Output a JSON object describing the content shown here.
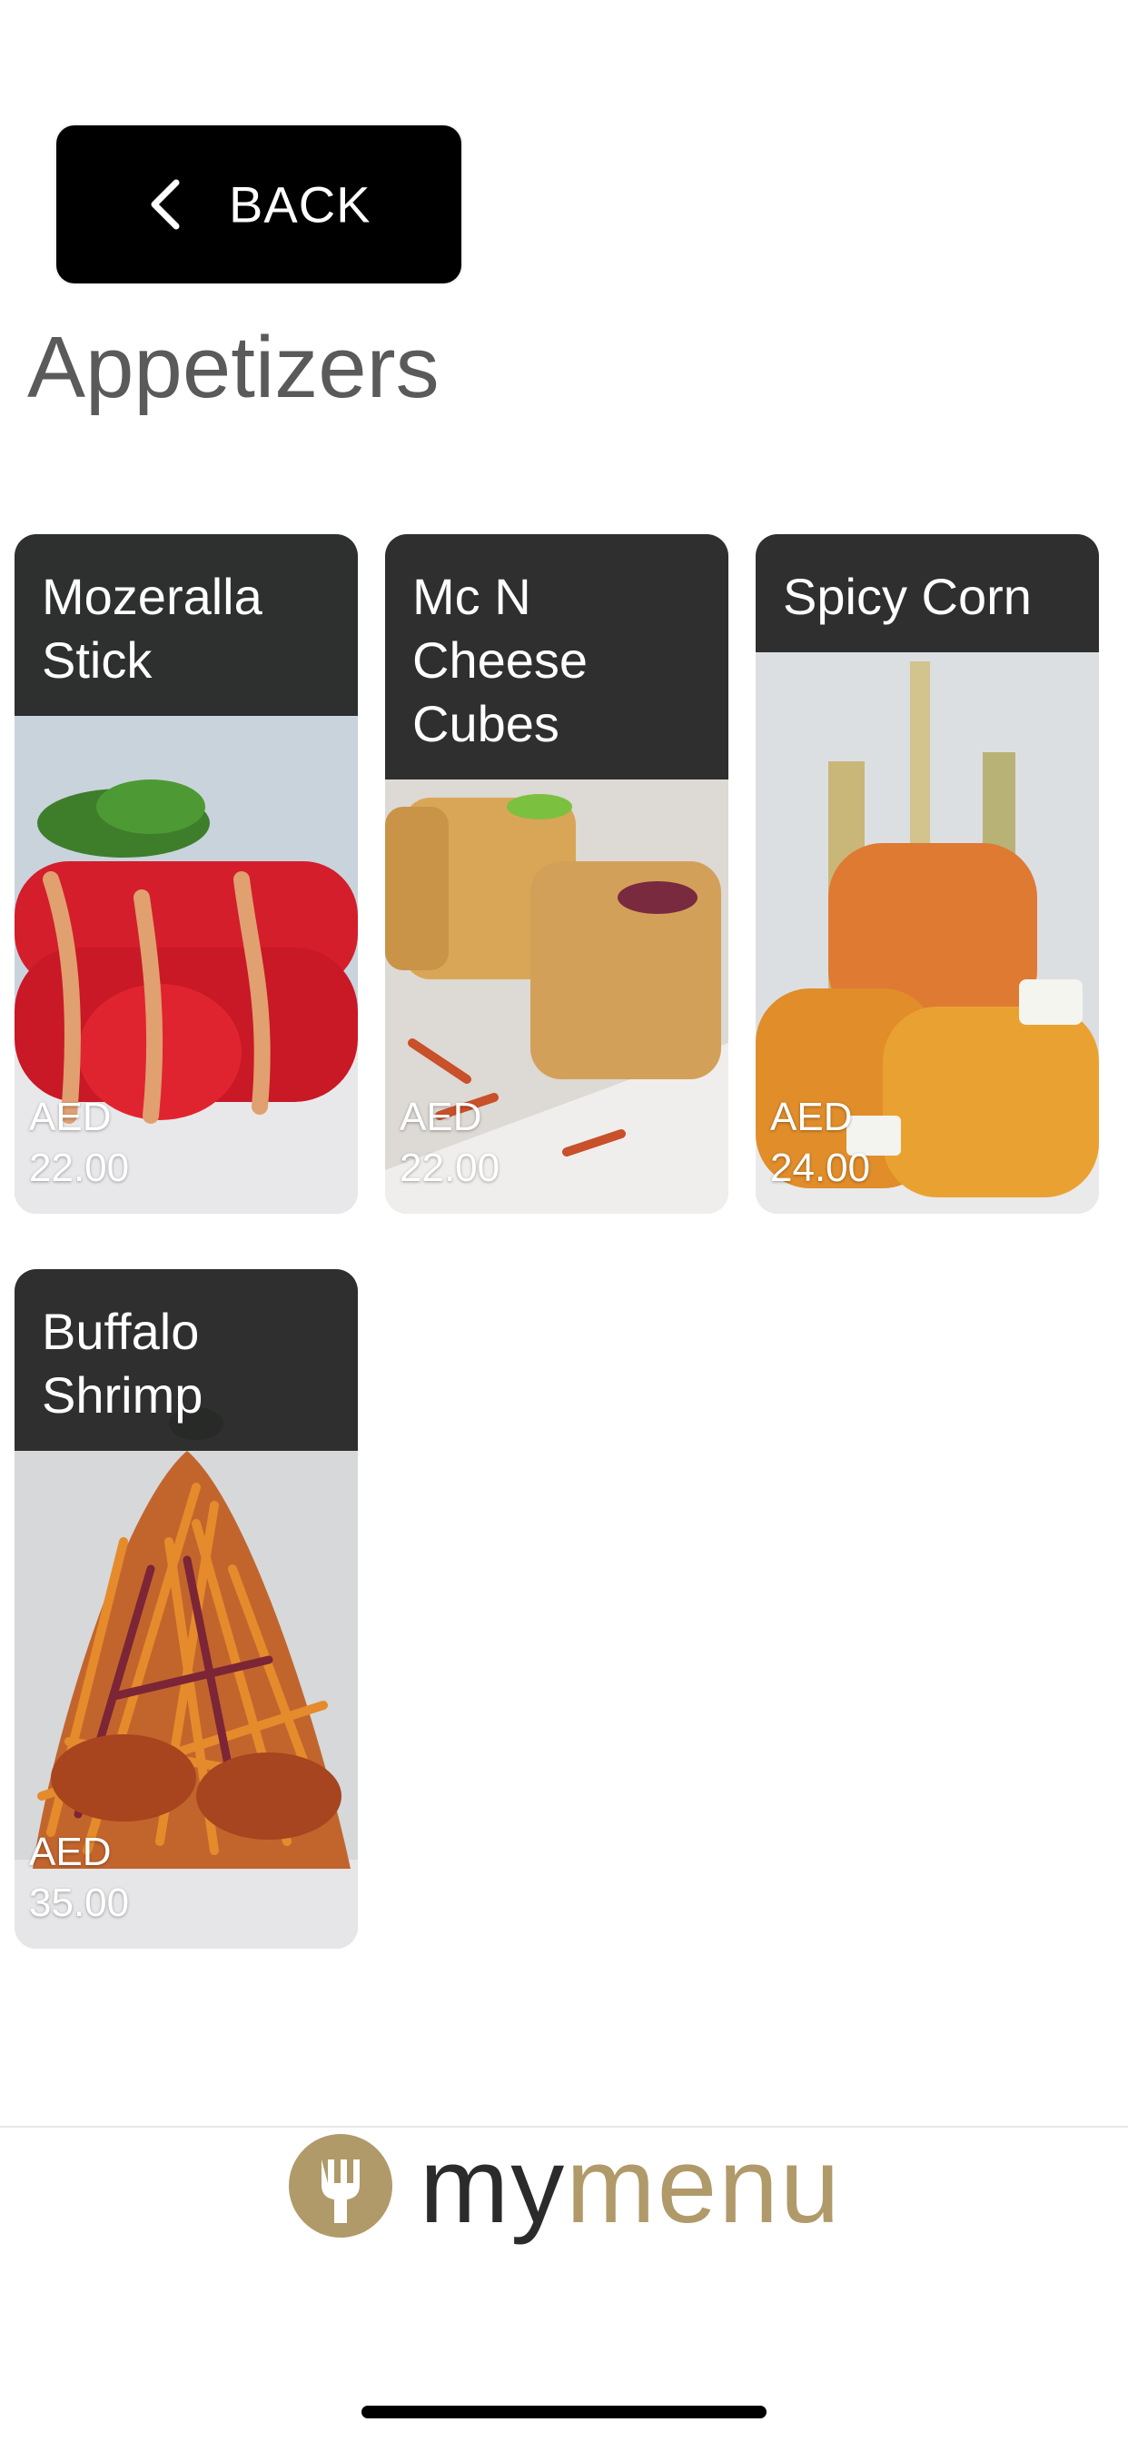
{
  "header": {
    "back_label": "BACK",
    "title": "Appetizers"
  },
  "items": [
    {
      "name": "Mozeralla Stick",
      "currency": "AED",
      "price": "22.00"
    },
    {
      "name": "Mc N Cheese Cubes",
      "currency": "AED",
      "price": "22.00"
    },
    {
      "name": "Spicy Corn",
      "currency": "AED",
      "price": "24.00"
    },
    {
      "name": "Buffalo Shrimp",
      "currency": "AED",
      "price": "35.00"
    }
  ],
  "footer": {
    "logo_part1": "my",
    "logo_part2": "menu"
  },
  "colors": {
    "back_button_bg": "#000000",
    "title_text": "#5a5a5a",
    "name_bar_bg": "#282828",
    "logo_gold": "#b09a6a",
    "logo_dark": "#2b2b2b"
  },
  "icons": {
    "back": "chevron-left-icon",
    "logo": "fork-icon"
  }
}
